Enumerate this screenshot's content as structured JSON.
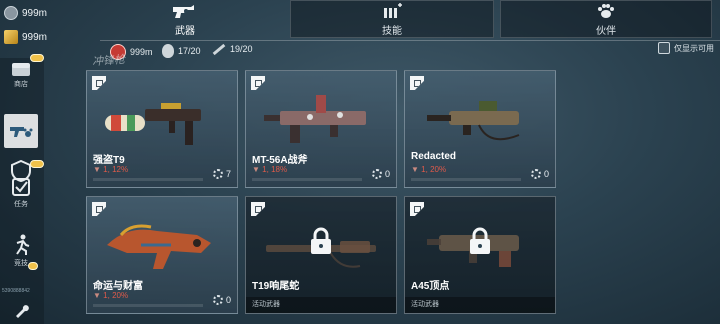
{
  "currency": {
    "silver": "999m",
    "gold": "999m"
  },
  "sidebar": {
    "items": [
      {
        "label": "商店",
        "icon": "chest-icon"
      },
      {
        "label": "",
        "icon": "gun-paw-icon"
      },
      {
        "label": "",
        "icon": "shield-icon"
      },
      {
        "label": "任务",
        "icon": "checklist-icon"
      },
      {
        "label": "竞技",
        "icon": "runner-icon"
      },
      {
        "label": "",
        "icon": "wrench-icon"
      }
    ],
    "footer_text": "5390888842"
  },
  "tabs": [
    {
      "label": "武器",
      "icon": "revolver-icon"
    },
    {
      "label": "技能",
      "icon": "bullets-plus-icon"
    },
    {
      "label": "伙伴",
      "icon": "paw-icon"
    }
  ],
  "stats": {
    "badge_value": "999m",
    "grenades": "17/20",
    "melee": "19/20"
  },
  "toggle_label": "仅显示可用",
  "section_watermark": "冲锋枪",
  "cards": [
    {
      "name": "强盗T9",
      "level": "1",
      "stat": "12%",
      "count": "7",
      "locked": false
    },
    {
      "name": "MT-56A战斧",
      "level": "1",
      "stat": "18%",
      "count": "0",
      "locked": false
    },
    {
      "name": "Redacted",
      "level": "1",
      "stat": "20%",
      "count": "0",
      "locked": false
    },
    {
      "name": "命运与财富",
      "level": "1",
      "stat": "20%",
      "count": "0",
      "locked": false
    },
    {
      "name": "T19响尾蛇",
      "note": "活动武器",
      "locked": true
    },
    {
      "name": "A45顶点",
      "note": "活动武器",
      "locked": true
    }
  ],
  "colors": {
    "accent_red": "#e05a4a",
    "gold": "#f1c24a"
  }
}
